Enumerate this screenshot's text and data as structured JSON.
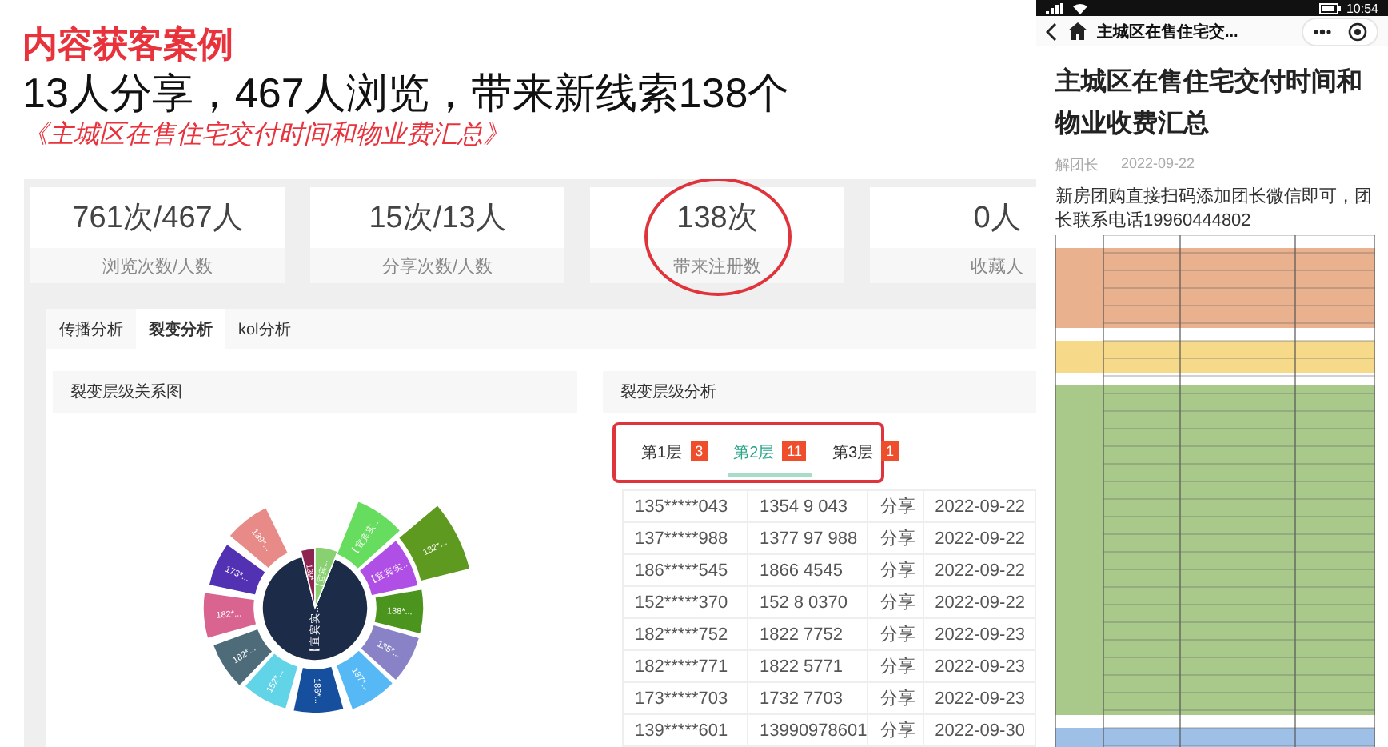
{
  "slide": {
    "title": "内容获客案例",
    "headline": "13人分享，467人浏览，带来新线索138个",
    "subtitle": "《主城区在售住宅交付时间和物业费汇总》"
  },
  "stats": [
    {
      "value": "761次/467人",
      "label": "浏览次数/人数",
      "circled": false
    },
    {
      "value": "15次/13人",
      "label": "分享次数/人数",
      "circled": false
    },
    {
      "value": "138次",
      "label": "带来注册数",
      "circled": true
    },
    {
      "value": "0人",
      "label": "收藏人",
      "circled": false
    }
  ],
  "analysis_tabs": [
    {
      "label": "传播分析",
      "selected": false
    },
    {
      "label": "裂变分析",
      "selected": true
    },
    {
      "label": "kol分析",
      "selected": false
    }
  ],
  "relation_panel": {
    "title": "裂变层级关系图",
    "center": {
      "label": "【宜宾实...",
      "color": "#1c2b47"
    },
    "segments": [
      {
        "label": "139*...",
        "color": "#8c2350"
      },
      {
        "label": "【宜宾...",
        "color": "#88d070"
      },
      {
        "label": "【宜宾实...",
        "color": "#66dd5e"
      },
      {
        "label": "【宜宾实...",
        "color": "#b04fe6"
      },
      {
        "label": "182*...",
        "color": "#5f9a20"
      },
      {
        "label": "138*...",
        "color": "#4b951e"
      },
      {
        "label": "135*...",
        "color": "#8a82c6"
      },
      {
        "label": "137*...",
        "color": "#56b9f6"
      },
      {
        "label": "186*...",
        "color": "#174f9f"
      },
      {
        "label": "152*...",
        "color": "#62d4e8"
      },
      {
        "label": "182*...",
        "color": "#4e6b7a"
      },
      {
        "label": "182*...",
        "color": "#d96490"
      },
      {
        "label": "173*...",
        "color": "#5232b2"
      },
      {
        "label": "139*...",
        "color": "#e88b88"
      }
    ]
  },
  "layer_panel": {
    "title": "裂变层级分析",
    "highlighted": true,
    "layers": [
      {
        "label": "第1层",
        "count": "3",
        "selected": false
      },
      {
        "label": "第2层",
        "count": "11",
        "selected": true
      },
      {
        "label": "第3层",
        "count": "1",
        "selected": false
      }
    ],
    "rows": [
      {
        "user": "135*****043",
        "phone": "1354 9 043",
        "action": "分享",
        "time": "2022-09-22"
      },
      {
        "user": "137*****988",
        "phone": "1377 97 988",
        "action": "分享",
        "time": "2022-09-22"
      },
      {
        "user": "186*****545",
        "phone": "1866 4545",
        "action": "分享",
        "time": "2022-09-22"
      },
      {
        "user": "152*****370",
        "phone": "152 8 0370",
        "action": "分享",
        "time": "2022-09-22"
      },
      {
        "user": "182*****752",
        "phone": "1822 7752",
        "action": "分享",
        "time": "2022-09-23"
      },
      {
        "user": "182*****771",
        "phone": "1822 5771",
        "action": "分享",
        "time": "2022-09-23"
      },
      {
        "user": "173*****703",
        "phone": "1732 7703",
        "action": "分享",
        "time": "2022-09-23"
      },
      {
        "user": "139*****601",
        "phone": "13990978601",
        "action": "分享",
        "time": "2022-09-30"
      }
    ]
  },
  "phone": {
    "time": "10:54",
    "nav_title": "主城区在售住宅交...",
    "article": {
      "title": "主城区在售住宅交付时间和物业收费汇总",
      "author": "解团长",
      "date": "2022-09-22",
      "body": "新房团购直接扫码添加团长微信即可，团长联系电话19960444802"
    }
  }
}
